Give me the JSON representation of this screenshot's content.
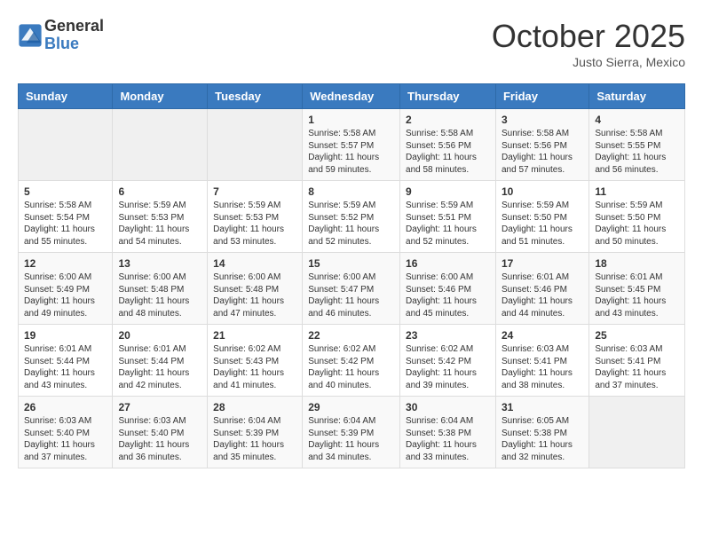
{
  "header": {
    "logo_general": "General",
    "logo_blue": "Blue",
    "month": "October 2025",
    "location": "Justo Sierra, Mexico"
  },
  "weekdays": [
    "Sunday",
    "Monday",
    "Tuesday",
    "Wednesday",
    "Thursday",
    "Friday",
    "Saturday"
  ],
  "weeks": [
    [
      {
        "day": "",
        "empty": true
      },
      {
        "day": "",
        "empty": true
      },
      {
        "day": "",
        "empty": true
      },
      {
        "day": "1",
        "sunrise": "5:58 AM",
        "sunset": "5:57 PM",
        "daylight": "11 hours and 59 minutes."
      },
      {
        "day": "2",
        "sunrise": "5:58 AM",
        "sunset": "5:56 PM",
        "daylight": "11 hours and 58 minutes."
      },
      {
        "day": "3",
        "sunrise": "5:58 AM",
        "sunset": "5:56 PM",
        "daylight": "11 hours and 57 minutes."
      },
      {
        "day": "4",
        "sunrise": "5:58 AM",
        "sunset": "5:55 PM",
        "daylight": "11 hours and 56 minutes."
      }
    ],
    [
      {
        "day": "5",
        "sunrise": "5:58 AM",
        "sunset": "5:54 PM",
        "daylight": "11 hours and 55 minutes."
      },
      {
        "day": "6",
        "sunrise": "5:59 AM",
        "sunset": "5:53 PM",
        "daylight": "11 hours and 54 minutes."
      },
      {
        "day": "7",
        "sunrise": "5:59 AM",
        "sunset": "5:53 PM",
        "daylight": "11 hours and 53 minutes."
      },
      {
        "day": "8",
        "sunrise": "5:59 AM",
        "sunset": "5:52 PM",
        "daylight": "11 hours and 52 minutes."
      },
      {
        "day": "9",
        "sunrise": "5:59 AM",
        "sunset": "5:51 PM",
        "daylight": "11 hours and 52 minutes."
      },
      {
        "day": "10",
        "sunrise": "5:59 AM",
        "sunset": "5:50 PM",
        "daylight": "11 hours and 51 minutes."
      },
      {
        "day": "11",
        "sunrise": "5:59 AM",
        "sunset": "5:50 PM",
        "daylight": "11 hours and 50 minutes."
      }
    ],
    [
      {
        "day": "12",
        "sunrise": "6:00 AM",
        "sunset": "5:49 PM",
        "daylight": "11 hours and 49 minutes."
      },
      {
        "day": "13",
        "sunrise": "6:00 AM",
        "sunset": "5:48 PM",
        "daylight": "11 hours and 48 minutes."
      },
      {
        "day": "14",
        "sunrise": "6:00 AM",
        "sunset": "5:48 PM",
        "daylight": "11 hours and 47 minutes."
      },
      {
        "day": "15",
        "sunrise": "6:00 AM",
        "sunset": "5:47 PM",
        "daylight": "11 hours and 46 minutes."
      },
      {
        "day": "16",
        "sunrise": "6:00 AM",
        "sunset": "5:46 PM",
        "daylight": "11 hours and 45 minutes."
      },
      {
        "day": "17",
        "sunrise": "6:01 AM",
        "sunset": "5:46 PM",
        "daylight": "11 hours and 44 minutes."
      },
      {
        "day": "18",
        "sunrise": "6:01 AM",
        "sunset": "5:45 PM",
        "daylight": "11 hours and 43 minutes."
      }
    ],
    [
      {
        "day": "19",
        "sunrise": "6:01 AM",
        "sunset": "5:44 PM",
        "daylight": "11 hours and 43 minutes."
      },
      {
        "day": "20",
        "sunrise": "6:01 AM",
        "sunset": "5:44 PM",
        "daylight": "11 hours and 42 minutes."
      },
      {
        "day": "21",
        "sunrise": "6:02 AM",
        "sunset": "5:43 PM",
        "daylight": "11 hours and 41 minutes."
      },
      {
        "day": "22",
        "sunrise": "6:02 AM",
        "sunset": "5:42 PM",
        "daylight": "11 hours and 40 minutes."
      },
      {
        "day": "23",
        "sunrise": "6:02 AM",
        "sunset": "5:42 PM",
        "daylight": "11 hours and 39 minutes."
      },
      {
        "day": "24",
        "sunrise": "6:03 AM",
        "sunset": "5:41 PM",
        "daylight": "11 hours and 38 minutes."
      },
      {
        "day": "25",
        "sunrise": "6:03 AM",
        "sunset": "5:41 PM",
        "daylight": "11 hours and 37 minutes."
      }
    ],
    [
      {
        "day": "26",
        "sunrise": "6:03 AM",
        "sunset": "5:40 PM",
        "daylight": "11 hours and 37 minutes."
      },
      {
        "day": "27",
        "sunrise": "6:03 AM",
        "sunset": "5:40 PM",
        "daylight": "11 hours and 36 minutes."
      },
      {
        "day": "28",
        "sunrise": "6:04 AM",
        "sunset": "5:39 PM",
        "daylight": "11 hours and 35 minutes."
      },
      {
        "day": "29",
        "sunrise": "6:04 AM",
        "sunset": "5:39 PM",
        "daylight": "11 hours and 34 minutes."
      },
      {
        "day": "30",
        "sunrise": "6:04 AM",
        "sunset": "5:38 PM",
        "daylight": "11 hours and 33 minutes."
      },
      {
        "day": "31",
        "sunrise": "6:05 AM",
        "sunset": "5:38 PM",
        "daylight": "11 hours and 32 minutes."
      },
      {
        "day": "",
        "empty": true
      }
    ]
  ]
}
